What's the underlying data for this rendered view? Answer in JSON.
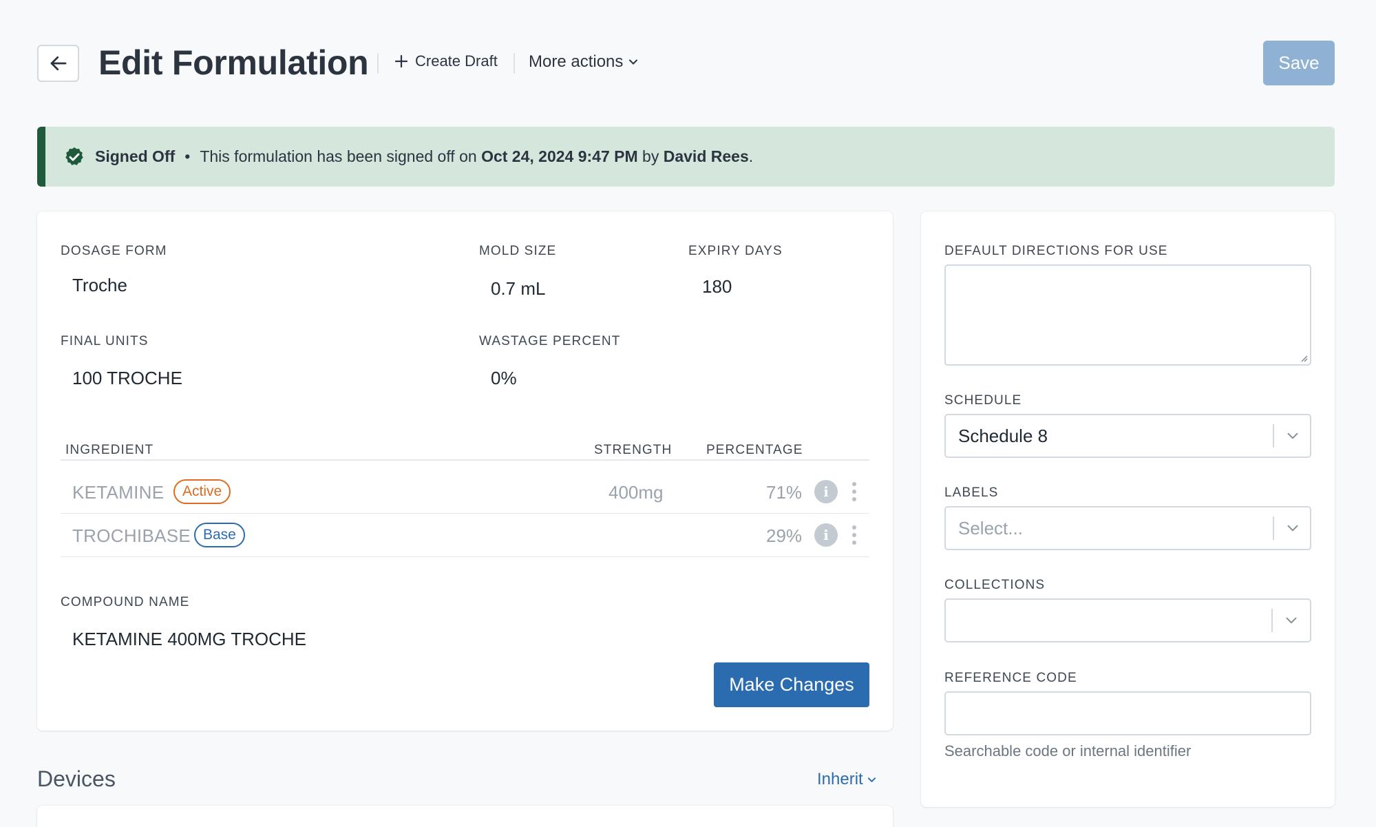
{
  "header": {
    "title": "Edit Formulation",
    "create_draft_label": "Create Draft",
    "more_actions_label": "More actions",
    "save_label": "Save"
  },
  "banner": {
    "status": "Signed Off",
    "separator": "•",
    "text_before": "This formulation has been signed off on",
    "date": "Oct 24, 2024 9:47 PM",
    "by": "by",
    "signer": "David Rees",
    "end": "."
  },
  "details": {
    "dosage_form_label": "DOSAGE FORM",
    "dosage_form_value": "Troche",
    "mold_size_label": "MOLD SIZE",
    "mold_size_value": "0.7 mL",
    "expiry_days_label": "EXPIRY DAYS",
    "expiry_days_value": "180",
    "final_units_label": "FINAL UNITS",
    "final_units_value": "100 TROCHE",
    "wastage_label": "WASTAGE PERCENT",
    "wastage_value": "0%"
  },
  "ingredients": {
    "headers": {
      "ingredient": "INGREDIENT",
      "strength": "STRENGTH",
      "percentage": "PERCENTAGE"
    },
    "rows": [
      {
        "name": "KETAMINE",
        "tag": "Active",
        "strength": "400mg",
        "percentage": "71%"
      },
      {
        "name": "TROCHIBASE",
        "tag": "Base",
        "strength": "",
        "percentage": "29%"
      }
    ]
  },
  "compound": {
    "label": "COMPOUND NAME",
    "value": "KETAMINE 400MG TROCHE",
    "make_changes_label": "Make Changes"
  },
  "sidebar": {
    "directions_label": "DEFAULT DIRECTIONS FOR USE",
    "directions_value": "",
    "schedule_label": "SCHEDULE",
    "schedule_value": "Schedule 8",
    "labels_label": "LABELS",
    "labels_placeholder": "Select...",
    "collections_label": "COLLECTIONS",
    "collections_value": "",
    "reference_label": "REFERENCE CODE",
    "reference_value": "",
    "reference_help": "Searchable code or internal identifier"
  },
  "devices": {
    "title": "Devices",
    "inherit_label": "Inherit"
  },
  "colors": {
    "primary": "#2b6cb0",
    "save_disabled": "#8fb2d4",
    "banner_bg": "#d5e6dc",
    "banner_accent": "#1f5a3a",
    "active_tag": "#dd6b20"
  }
}
